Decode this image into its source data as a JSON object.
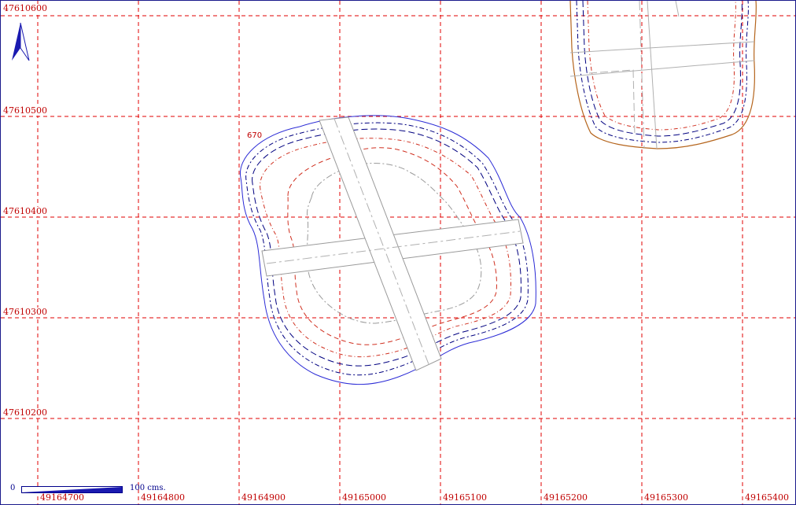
{
  "map": {
    "grid_x_labels": [
      "49164700",
      "49164800",
      "49164900",
      "49165000",
      "49165100",
      "49165200",
      "49165300",
      "49165400"
    ],
    "grid_y_labels": [
      "47610600",
      "47610500",
      "47610400",
      "47610300",
      "47610200"
    ],
    "contour_label": "670",
    "scale": {
      "start": "0",
      "end": "100",
      "unit": "cms."
    },
    "north_arrow": "north-arrow-icon",
    "colors": {
      "grid": "#e00000",
      "outer_contour": "#2b2bd6",
      "dark_contour": "#000080",
      "red_contour": "#d03020",
      "gray_contour": "#9a9a9a",
      "brown_contour": "#b5651d"
    }
  }
}
